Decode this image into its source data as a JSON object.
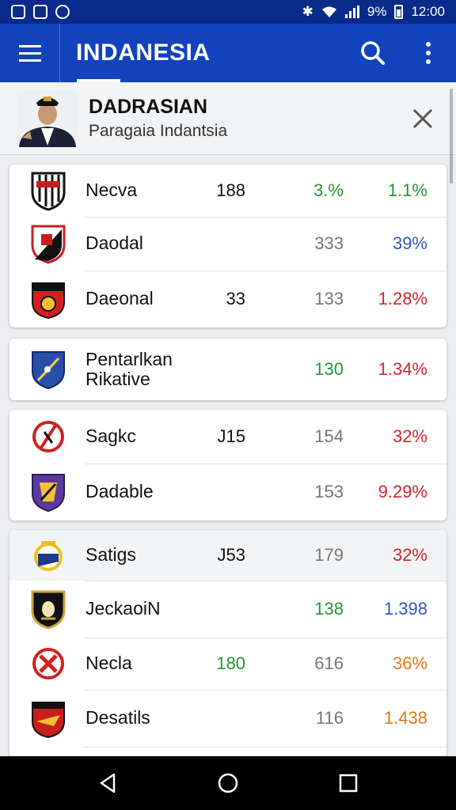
{
  "status_bar": {
    "time": "12:00",
    "battery": "9%"
  },
  "app_bar": {
    "title": "INDANESIA"
  },
  "banner": {
    "title": "DADRASIAN",
    "subtitle": "Paragaia Indantsia"
  },
  "colors": {
    "app_bar": "#1243bd",
    "status_bar": "#0b2b8a",
    "green": "#1f9a2e",
    "red": "#d0262b",
    "blue": "#2f59c4",
    "orange": "#e07a12"
  },
  "groups": [
    {
      "rows": [
        {
          "name": "Necva",
          "col1": "188",
          "col2": "3.%",
          "col3": "1.1%",
          "crest": "striped-shield-crest"
        },
        {
          "name": "Daodal",
          "col1": "",
          "col2": "333",
          "col3": "39%",
          "crest": "red-black-shield-crest"
        },
        {
          "name": "Daeonal",
          "col1": "33",
          "col2": "133",
          "col3": "1.28%",
          "crest": "red-ball-crest"
        }
      ]
    },
    {
      "rows": [
        {
          "name": "Pentarlkan\nRikative",
          "col1": "",
          "col2": "130",
          "col3": "1.34%",
          "crest": "blue-sword-shield-crest"
        }
      ]
    },
    {
      "rows": [
        {
          "name": "Sagkc",
          "col1": "J15",
          "col2": "154",
          "col3": "32%",
          "crest": "prohibited-circle-crest"
        },
        {
          "name": "Dadable",
          "col1": "",
          "col2": "153",
          "col3": "9.29%",
          "crest": "purple-shield-crest"
        }
      ]
    },
    {
      "rows": [
        {
          "name": "Satigs",
          "col1": "J53",
          "col2": "179",
          "col3": "32%",
          "crest": "yellow-badge-crest"
        },
        {
          "name": "JeckaoiN",
          "col1": "",
          "col2": "138",
          "col3": "1.398",
          "crest": "black-gold-shield-crest"
        },
        {
          "name": "Necla",
          "col1": "180",
          "col2": "616",
          "col3": "36%",
          "crest": "red-x-circle-crest"
        },
        {
          "name": "Desatils",
          "col1": "",
          "col2": "116",
          "col3": "1.438",
          "crest": "red-bird-shield-crest"
        }
      ]
    }
  ]
}
